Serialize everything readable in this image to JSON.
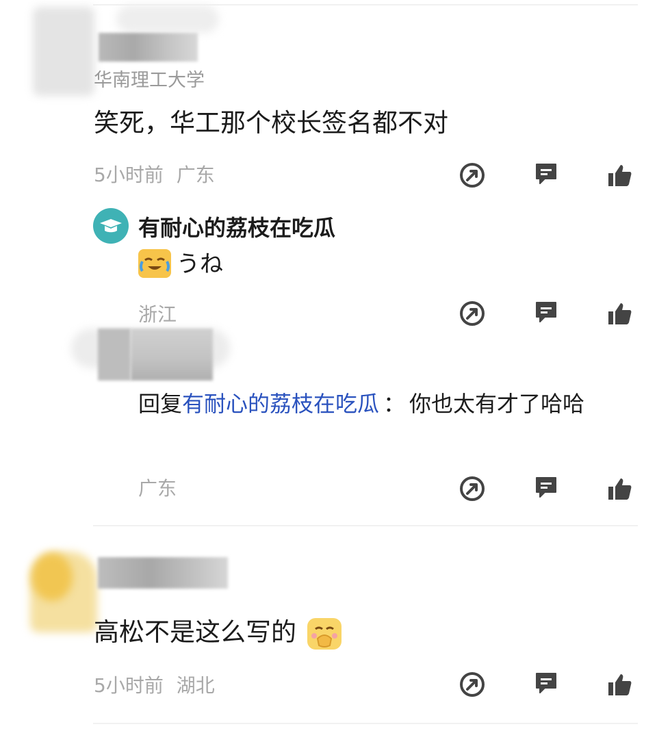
{
  "comments": [
    {
      "school": "华南理工大学",
      "text": "笑死，华工那个校长签名都不对",
      "time": "5小时前",
      "location": "广东"
    },
    {
      "text": "高松不是这么写的",
      "time": "5小时前",
      "location": "湖北"
    }
  ],
  "replies": [
    {
      "name": "有耐心的荔枝在吃瓜",
      "text": "うね",
      "location": "浙江"
    },
    {
      "prefix": "回复",
      "target": "有耐心的荔枝在吃瓜",
      "separator": "：",
      "text": "你也太有才了哈哈",
      "location": "广东"
    }
  ],
  "icons": {
    "share": "share-icon",
    "comment": "comment-icon",
    "like": "thumbs-up-icon",
    "badge": "graduation-cap-icon"
  },
  "colors": {
    "badge": "#3fb2b5",
    "link": "#2a52be",
    "icon": "#444444",
    "meta": "#a8a8a8"
  }
}
